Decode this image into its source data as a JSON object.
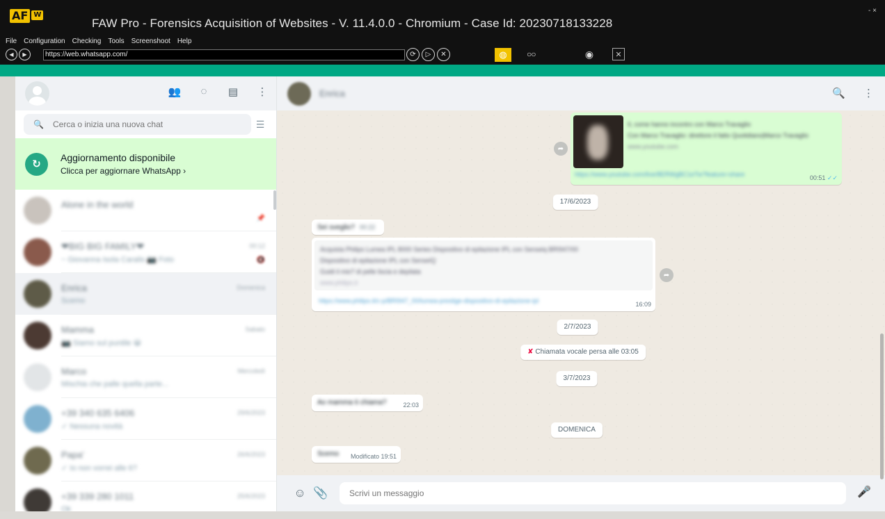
{
  "faw": {
    "logo_a": "AF",
    "logo_w": "W",
    "title": "FAW Pro - Forensics Acquisition of Websites - V. 11.4.0.0 - Chromium  - Case Id: 20230718133228",
    "menu": [
      "File",
      "Configuration",
      "Checking",
      "Tools",
      "Screenshoot",
      "Help"
    ],
    "url": "https://web.whatsapp.com/",
    "window_controls": "- ×"
  },
  "sidebar": {
    "search_placeholder": "Cerca o inizia una nuova chat",
    "update_title": "Aggiornamento disponibile",
    "update_sub": "Clicca per aggiornare WhatsApp ›",
    "chats": [
      {
        "name": "Alone in the world",
        "msg": "",
        "time": "",
        "avatar": "#c9c3bd"
      },
      {
        "name": "❤BIG BIG FAMILY❤",
        "msg": "~ Giovanna Isola Caralis 📷 Foto",
        "time": "00:12",
        "avatar": "#8a5a4c"
      },
      {
        "name": "Enrica",
        "msg": "Scemo",
        "time": "Domenica",
        "avatar": "#5e5b48"
      },
      {
        "name": "Mamma",
        "msg": "📷 Siamo sul puntile 😀",
        "time": "Sabato",
        "avatar": "#4c3a33"
      },
      {
        "name": "Marco",
        "msg": "Mischia che palle quella parte...",
        "time": "Mercoledì",
        "avatar": "#e2e5e7"
      },
      {
        "name": "+39 340 635 6406",
        "msg": "✓ Nessuna novità",
        "time": "29/6/2023",
        "avatar": "#7fb1cf"
      },
      {
        "name": "Papa'",
        "msg": "✓ Io non vorrei alle 6?",
        "time": "26/6/2023",
        "avatar": "#6f6a4f"
      },
      {
        "name": "+39 339 280 1011",
        "msg": "Ok",
        "time": "25/6/2023",
        "avatar": "#3f3a36"
      }
    ]
  },
  "conversation": {
    "contact_name": "Enrica",
    "link_preview_title": "Il, come hanno incontro con Marco Travaglio",
    "link_preview_sub": "Con Marco Travaglio: direttore il fatto Quotidiano|Marco Travaglio",
    "link_preview_url": "www.youtube.com",
    "link_url": "https://www.youtube.com/live/8ERWgBC1eTw?feature=share",
    "link_time": "00:51",
    "date1": "17/6/2023",
    "msg_sei_sveglio": "Sei sveglio?",
    "msg_sei_sveglio_time": "00:22",
    "product_title": "Acquista Philips Lumea IPL 8000 Series Dispositivo di epilazione IPL con Senseiq BRI947/00",
    "product_sub": "Dispositivo di epilazione IPL con SenseIQ",
    "product_desc": "Guidi il mio? di pelle liscia e depilata",
    "product_domain": "www.philips.it",
    "product_url": "https://www.philips.it/c-p/BRI947_00/lumea-prestige-dispositivo-di-epilazione-ipl",
    "product_time": "16:09",
    "date2": "2/7/2023",
    "missed_call": "Chiamata vocale persa alle 03:05",
    "date3": "3/7/2023",
    "msg_mamma": "Ao mamma ti chiama?",
    "msg_mamma_time": "22:03",
    "date4": "DOMENICA",
    "msg_scemo": "Scemo",
    "msg_scemo_time": "Modificato 19:51",
    "composer_placeholder": "Scrivi un messaggio"
  },
  "colors": {
    "whatsapp_green": "#00a884",
    "faw_bg": "#111111",
    "faw_yellow": "#f2c200",
    "outgoing_bubble": "#d9fdd3",
    "update_banner": "#d9fdd3"
  }
}
